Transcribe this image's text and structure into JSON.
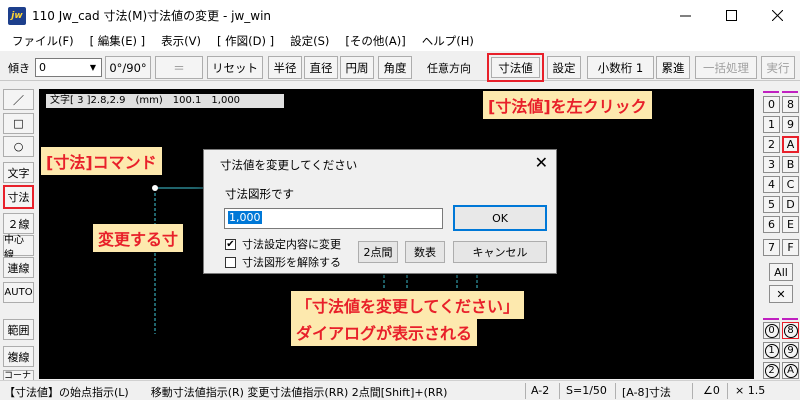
{
  "window": {
    "title": "110 Jw_cad 寸法(M)寸法値の変更 - jw_win",
    "app_icon_text": "jw"
  },
  "menu": [
    {
      "label": "ファイル(F)"
    },
    {
      "label": "[ 編集(E) ]"
    },
    {
      "label": "表示(V)"
    },
    {
      "label": "[ 作図(D) ]"
    },
    {
      "label": "設定(S)"
    },
    {
      "label": "[その他(A)]"
    },
    {
      "label": "ヘルプ(H)"
    }
  ],
  "toolbar": {
    "slope_label": "傾き",
    "slope_value": "0",
    "angle_btn": "0°/90°",
    "equal_btn": "＝",
    "reset_btn": "リセット",
    "radius_btn": "半径",
    "diameter_btn": "直径",
    "circumference_btn": "円周",
    "angle_dim_btn": "角度",
    "any_direction_label": "任意方向",
    "dim_value_btn": "寸法値",
    "settings_btn": "設定",
    "decimal_btn": "小数桁 1",
    "cumulative_btn": "累進",
    "batch_btn": "一括処理",
    "execute_btn": "実行"
  },
  "left_tools": [
    "／",
    "□",
    "○",
    "文字",
    "寸法",
    "２線",
    "中心線",
    "連線",
    "AUTO",
    "範囲",
    "複線",
    "コーナー"
  ],
  "right_tools": {
    "layer_groups_left": [
      "0",
      "1",
      "2",
      "3",
      "4",
      "5",
      "6",
      "7"
    ],
    "layer_groups_right": [
      "8",
      "9",
      "A",
      "B",
      "C",
      "D",
      "E",
      "F"
    ],
    "all_label": "All",
    "x_label": "✕",
    "layers_left": [
      "0",
      "1",
      "2"
    ],
    "layers_right": [
      "8",
      "9",
      "A"
    ]
  },
  "canvas": {
    "coord_text": "文字[ 3 ]2.8,2.9　(mm)　100.1　1,000"
  },
  "callouts": {
    "dim_value_click": "[寸法値]を左クリック",
    "dim_command": "[寸法]コマンド",
    "change_dim": "変更する寸",
    "dialog_shown_line1": "「寸法値を変更してください」",
    "dialog_shown_line2": "ダイアログが表示される"
  },
  "dialog": {
    "title": "寸法値を変更してください",
    "label": "寸法図形です",
    "value": "1,000",
    "ok": "OK",
    "cancel": "キャンセル",
    "two_points": "2点間",
    "formula": "数表",
    "chk_setting": "寸法設定内容に変更",
    "chk_setting_checked": true,
    "chk_release": "寸法図形を解除する",
    "chk_release_checked": false
  },
  "status": {
    "instruction": "【寸法値】の始点指示(L)　　移動寸法値指示(R)  変更寸法値指示(RR) 2点間[Shift]+(RR)",
    "paper": "A-2",
    "scale": "S=1/50",
    "layer": "[A-8]寸法",
    "angle": "∠0",
    "zoom": "× 1.5"
  },
  "colors": {
    "highlight_red": "#e8202a",
    "callout_bg": "#fde9ae",
    "canvas_bg": "#000000",
    "selection_blue": "#0078d7",
    "dim_line_cyan": "#40c8d8"
  }
}
